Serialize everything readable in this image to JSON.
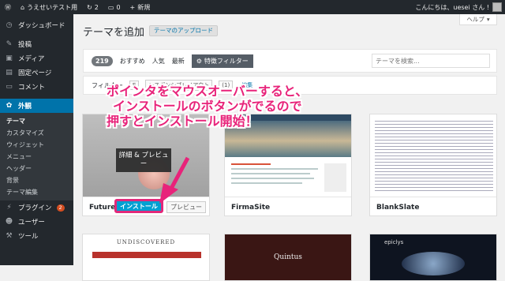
{
  "adminbar": {
    "site_name": "うえせいテスト用",
    "updates_count": "2",
    "comments_count": "0",
    "new_label": "新規",
    "greeting": "こんにちは、uesei さん !"
  },
  "sidebar": {
    "items": [
      {
        "label": "ダッシュボード",
        "icon": "dashboard-icon"
      },
      {
        "label": "投稿",
        "icon": "pin-icon"
      },
      {
        "label": "メディア",
        "icon": "media-icon"
      },
      {
        "label": "固定ページ",
        "icon": "page-icon"
      },
      {
        "label": "コメント",
        "icon": "comment-icon"
      },
      {
        "label": "外観",
        "icon": "appearance-icon"
      }
    ],
    "submenu": [
      "テーマ",
      "カスタマイズ",
      "ウィジェット",
      "メニュー",
      "ヘッダー",
      "背景",
      "テーマ編集"
    ],
    "items_after": [
      {
        "label": "プラグイン",
        "icon": "plugin-icon",
        "badge": "2"
      },
      {
        "label": "ユーザー",
        "icon": "user-icon"
      },
      {
        "label": "ツール",
        "icon": "tool-icon"
      }
    ]
  },
  "main": {
    "help_label": "ヘルプ",
    "title": "テーマを追加",
    "upload_label": "テーマのアップロード",
    "filter": {
      "count": "219",
      "tabs": [
        "おすすめ",
        "人気",
        "最新"
      ],
      "feature_label": "特徴フィルター",
      "search_placeholder": "テーマを検索..."
    },
    "filter2": {
      "label": "フィルター",
      "tags": [
        "E",
        "レスポンシブレイアウト",
        "(1)",
        "編集"
      ]
    },
    "themes": [
      "Future",
      "FirmaSite",
      "BlankSlate"
    ],
    "bottom_themes": [
      "UNDISCOVERED",
      "Quintus",
      "epiclys"
    ],
    "card_overlay": "詳細 & プレビュー",
    "install_label": "インストール",
    "preview_label": "プレビュー"
  },
  "annotation": {
    "lines": [
      "ポインタをマウスオーバーすると、",
      "インストールのボタンがでるので",
      "押すとインストール開始！"
    ]
  },
  "colors": {
    "adminbar": "#23282d",
    "accent": "#0073aa",
    "annotation": "#e8237a",
    "install": "#00a0d2"
  }
}
